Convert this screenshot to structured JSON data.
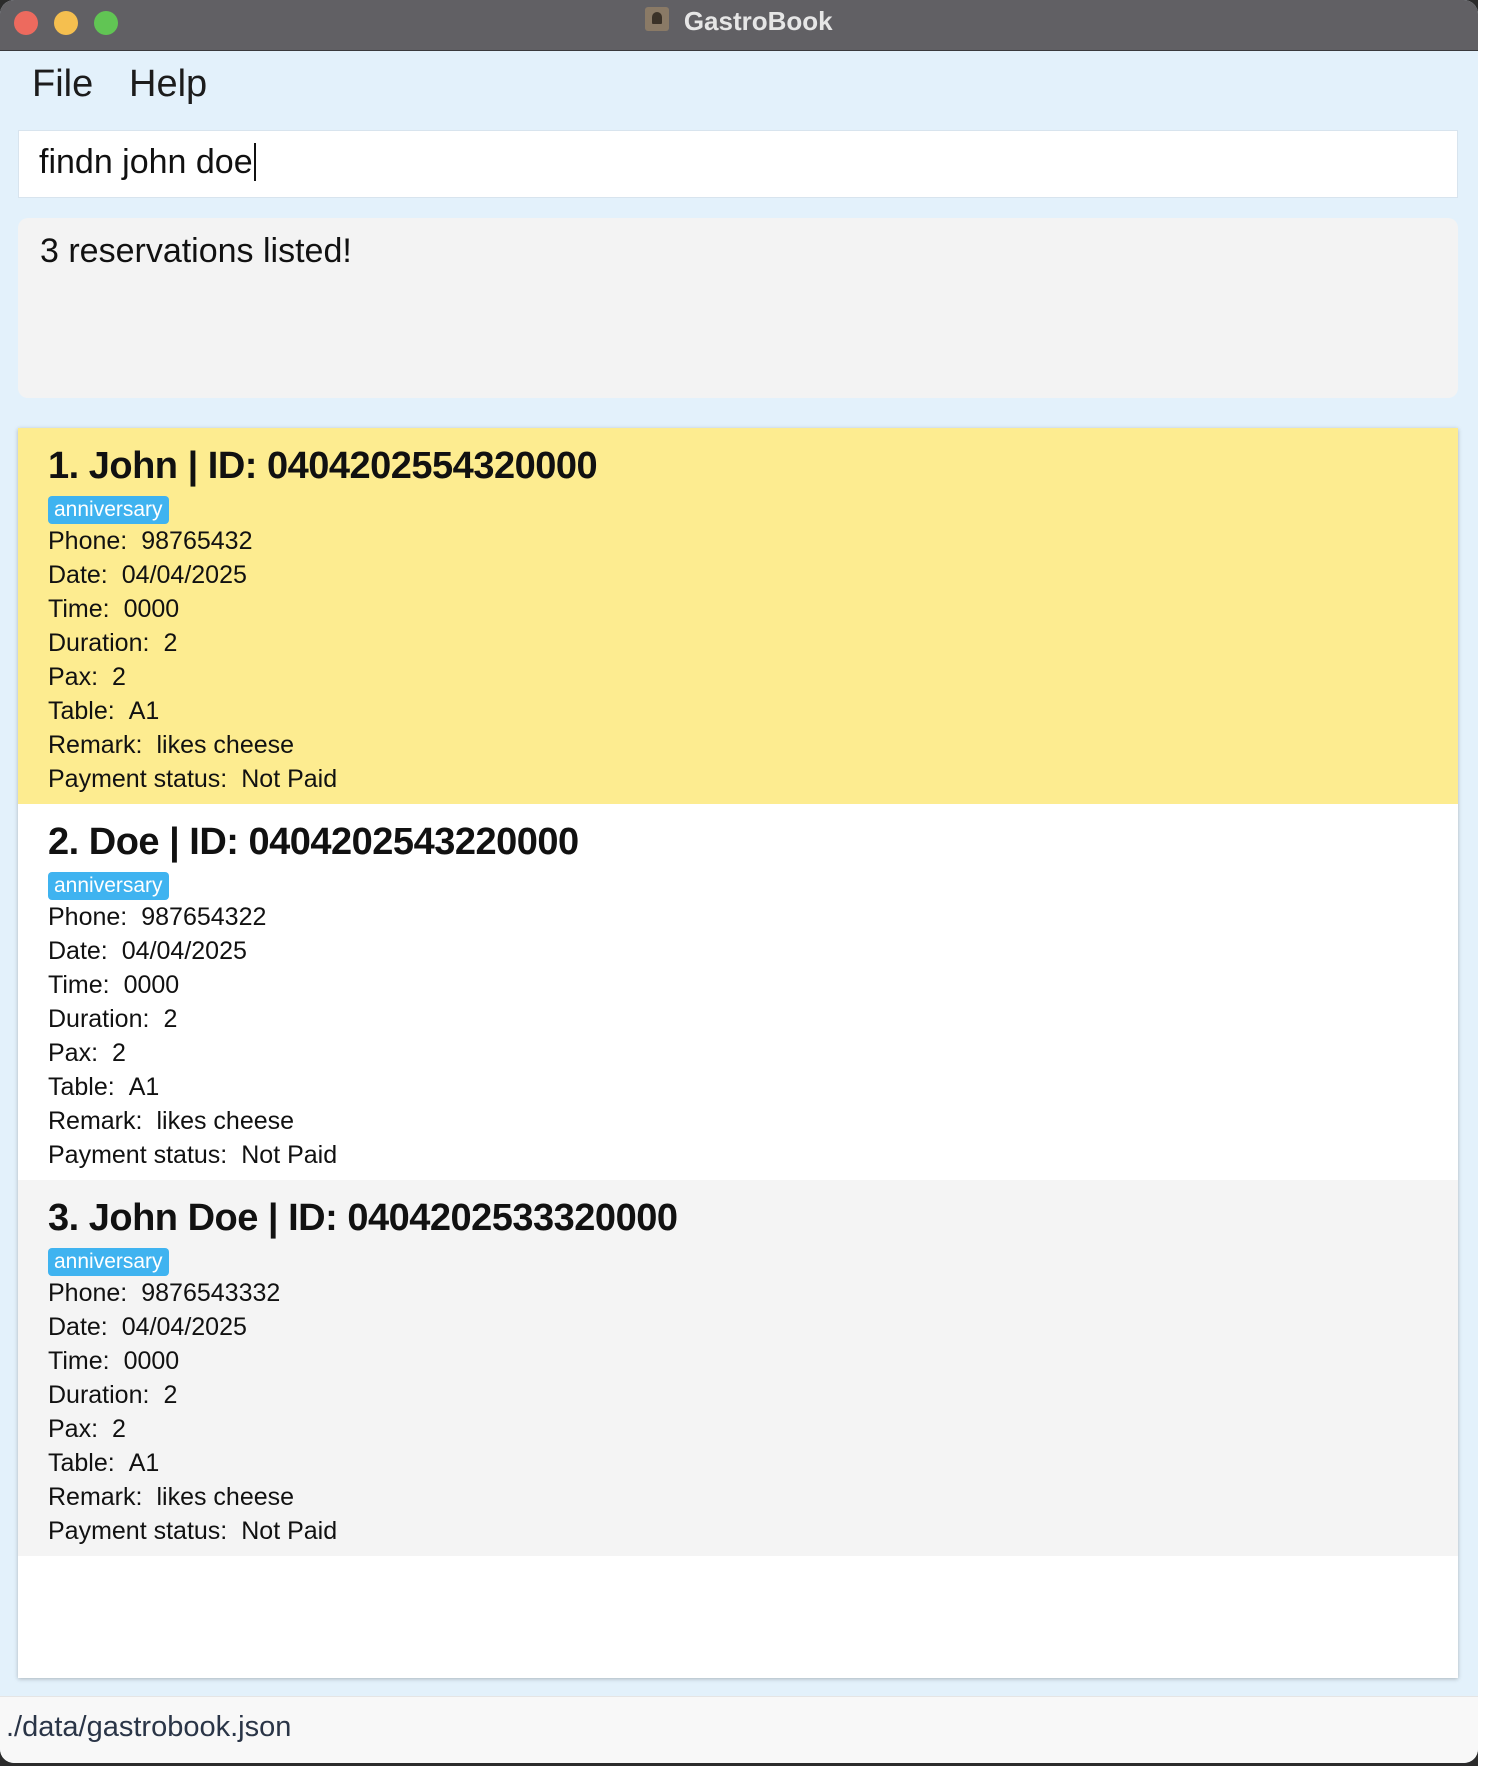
{
  "window": {
    "title": "GastroBook"
  },
  "menu": {
    "file": "File",
    "help": "Help"
  },
  "command": {
    "value": "findn john doe"
  },
  "result": {
    "message": "3 reservations listed!"
  },
  "reservations": [
    {
      "title": "1. John | ID: 0404202554320000",
      "tag": "anniversary",
      "background": "#fdec90",
      "fields": [
        {
          "label": "Phone:",
          "value": "98765432"
        },
        {
          "label": "Date:",
          "value": "04/04/2025"
        },
        {
          "label": "Time:",
          "value": "0000"
        },
        {
          "label": "Duration:",
          "value": "2"
        },
        {
          "label": "Pax:",
          "value": "2"
        },
        {
          "label": "Table:",
          "value": "A1"
        },
        {
          "label": "Remark:",
          "value": "likes cheese"
        },
        {
          "label": "Payment status:",
          "value": "Not Paid"
        }
      ]
    },
    {
      "title": "2. Doe | ID: 0404202543220000",
      "tag": "anniversary",
      "background": "#ffffff",
      "fields": [
        {
          "label": "Phone:",
          "value": "987654322"
        },
        {
          "label": "Date:",
          "value": "04/04/2025"
        },
        {
          "label": "Time:",
          "value": "0000"
        },
        {
          "label": "Duration:",
          "value": "2"
        },
        {
          "label": "Pax:",
          "value": "2"
        },
        {
          "label": "Table:",
          "value": "A1"
        },
        {
          "label": "Remark:",
          "value": "likes cheese"
        },
        {
          "label": "Payment status:",
          "value": "Not Paid"
        }
      ]
    },
    {
      "title": "3. John Doe | ID: 0404202533320000",
      "tag": "anniversary",
      "background": "#f4f4f4",
      "fields": [
        {
          "label": "Phone:",
          "value": "9876543332"
        },
        {
          "label": "Date:",
          "value": "04/04/2025"
        },
        {
          "label": "Time:",
          "value": "0000"
        },
        {
          "label": "Duration:",
          "value": "2"
        },
        {
          "label": "Pax:",
          "value": "2"
        },
        {
          "label": "Table:",
          "value": "A1"
        },
        {
          "label": "Remark:",
          "value": "likes cheese"
        },
        {
          "label": "Payment status:",
          "value": "Not Paid"
        }
      ]
    }
  ],
  "status_bar": {
    "path": "./data/gastrobook.json"
  }
}
